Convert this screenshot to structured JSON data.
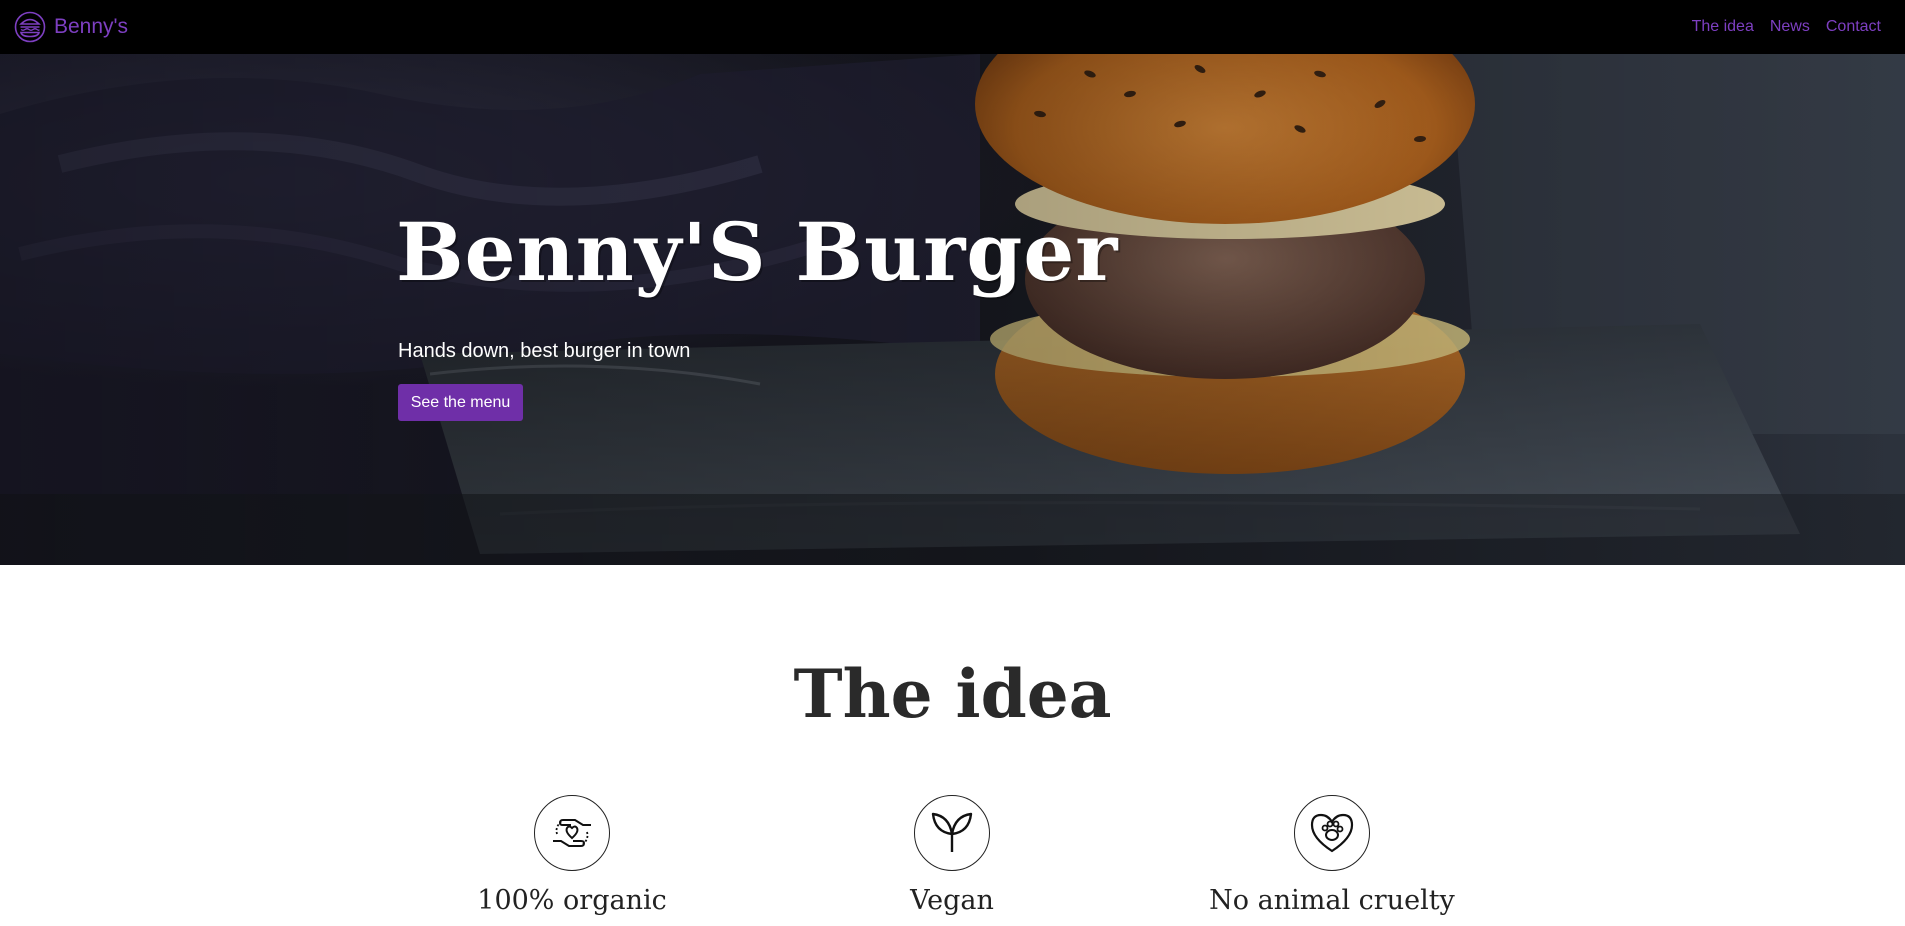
{
  "navbar": {
    "brand": "Benny's",
    "brand_icon": "burger-icon",
    "links": [
      "The idea",
      "News",
      "Contact"
    ]
  },
  "hero": {
    "title": "Benny'S Burger",
    "subtitle": "Hands down, best burger in town",
    "button": "See the menu"
  },
  "idea": {
    "title": "The idea",
    "features": [
      {
        "label": "100% organic",
        "icon": "hands-heart-icon"
      },
      {
        "label": "Vegan",
        "icon": "sprout-icon"
      },
      {
        "label": "No animal cruelty",
        "icon": "heart-paw-icon"
      }
    ]
  },
  "colors": {
    "accent": "#7d3fc1",
    "button": "#6f2fa8",
    "navbar_bg": "#000000"
  }
}
